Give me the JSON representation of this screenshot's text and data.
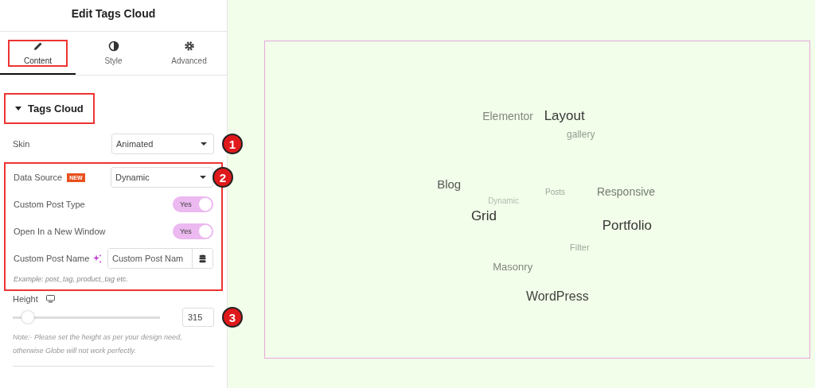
{
  "panel": {
    "title": "Edit Tags Cloud",
    "tabs": [
      {
        "label": "Content",
        "kind": "edit",
        "selected": true
      },
      {
        "label": "Style",
        "kind": "style",
        "selected": false
      },
      {
        "label": "Advanced",
        "kind": "advanced",
        "selected": false
      }
    ],
    "section": {
      "title": "Tags Cloud",
      "expanded": true
    },
    "skin": {
      "label": "Skin",
      "value": "Animated",
      "callout": "1"
    },
    "data_source": {
      "label": "Data Source",
      "badge": "NEW",
      "value": "Dynamic",
      "callout": "2"
    },
    "toggles": [
      {
        "label": "Custom Post Type",
        "text": "Yes",
        "on": true
      },
      {
        "label": "Open In a New Window",
        "text": "Yes",
        "on": true
      }
    ],
    "custom_post_name": {
      "label": "Custom Post Name",
      "placeholder": "Custom Post Nam",
      "hint": "Example: post_tag, product_tag etc."
    },
    "height": {
      "label": "Height",
      "level": 0.1,
      "value": "315",
      "callout": "3",
      "note": "Note:- Please set the height as per your design need, otherwise Globe will not work perfectly."
    }
  },
  "cloud": {
    "tags": [
      "Elementor",
      "Layout",
      "gallery",
      "Blog",
      "Dynamic",
      "Posts",
      "Responsive",
      "Grid",
      "Portfolio",
      "Filter",
      "Masonry",
      "WordPress"
    ]
  }
}
